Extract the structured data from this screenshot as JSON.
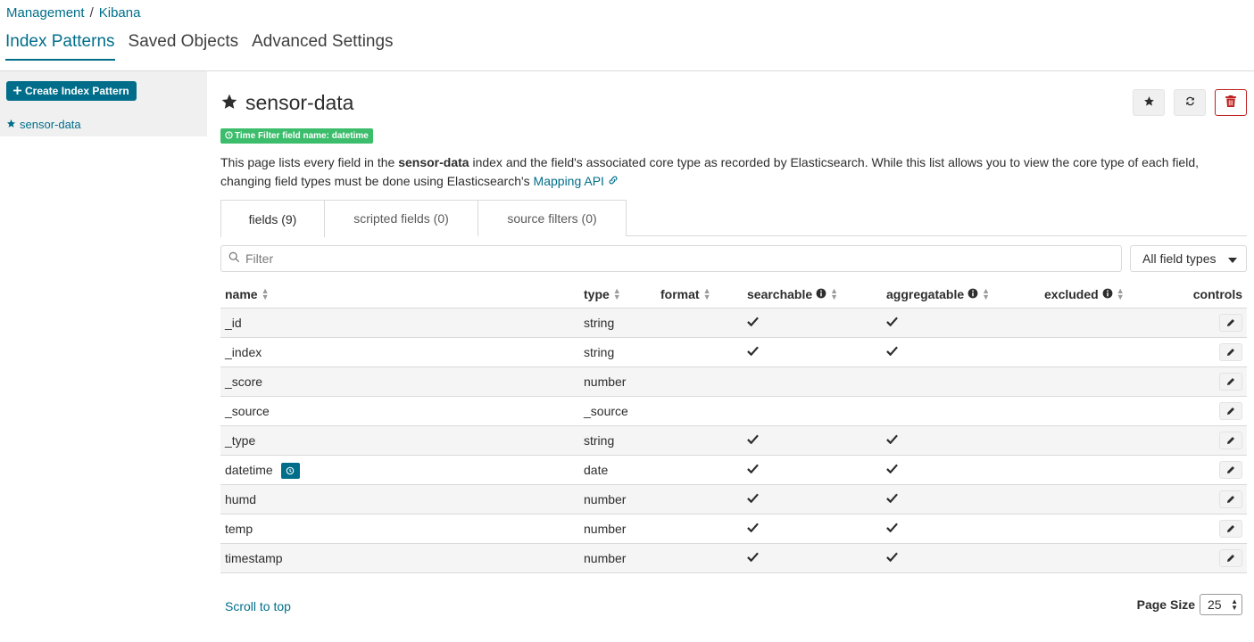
{
  "breadcrumb": [
    "Management",
    "Kibana"
  ],
  "nav": [
    "Index Patterns",
    "Saved Objects",
    "Advanced Settings"
  ],
  "sidebar": {
    "create_label": "Create Index Pattern",
    "items": [
      "sensor-data"
    ]
  },
  "pattern": {
    "title": "sensor-data",
    "time_badge": "Time Filter field name: datetime",
    "desc_pre": "This page lists every field in the ",
    "desc_bold": "sensor-data",
    "desc_post": " index and the field's associated core type as recorded by Elasticsearch. While this list allows you to view the core type of each field, changing field types must be done using Elasticsearch's ",
    "desc_link": "Mapping API"
  },
  "tabs": [
    "fields (9)",
    "scripted fields (0)",
    "source filters (0)"
  ],
  "filter": {
    "placeholder": "Filter",
    "type_select": "All field types"
  },
  "columns": [
    "name",
    "type",
    "format",
    "searchable",
    "aggregatable",
    "excluded",
    "controls"
  ],
  "rows": [
    {
      "name": "_id",
      "type": "string",
      "searchable": true,
      "aggregatable": true
    },
    {
      "name": "_index",
      "type": "string",
      "searchable": true,
      "aggregatable": true
    },
    {
      "name": "_score",
      "type": "number",
      "searchable": false,
      "aggregatable": false
    },
    {
      "name": "_source",
      "type": "_source",
      "searchable": false,
      "aggregatable": false
    },
    {
      "name": "_type",
      "type": "string",
      "searchable": true,
      "aggregatable": true
    },
    {
      "name": "datetime",
      "type": "date",
      "searchable": true,
      "aggregatable": true,
      "time_field": true
    },
    {
      "name": "humd",
      "type": "number",
      "searchable": true,
      "aggregatable": true
    },
    {
      "name": "temp",
      "type": "number",
      "searchable": true,
      "aggregatable": true
    },
    {
      "name": "timestamp",
      "type": "number",
      "searchable": true,
      "aggregatable": true
    }
  ],
  "footer": {
    "scroll_top": "Scroll to top",
    "page_size_label": "Page Size",
    "page_size": "25"
  },
  "colors": {
    "accent": "#006e8a",
    "success": "#3bbd6b",
    "danger": "#bf1f1f"
  }
}
